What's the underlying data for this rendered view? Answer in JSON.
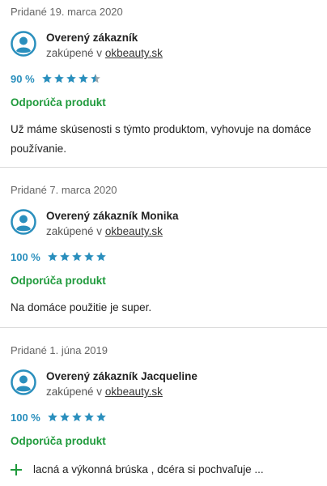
{
  "reviews": [
    {
      "date": "Pridané 19. marca 2020",
      "name": "Overený zákazník",
      "purchased_prefix": "zakúpené v ",
      "shop": "okbeauty.sk",
      "percent": "90 %",
      "stars": 4.5,
      "recommend": "Odporúča produkt",
      "text": "Už máme skúsenosti s týmto produktom, vyhovuje na domáce používanie."
    },
    {
      "date": "Pridané 7. marca 2020",
      "name": "Overený zákazník Monika",
      "purchased_prefix": "zakúpené v ",
      "shop": "okbeauty.sk",
      "percent": "100 %",
      "stars": 5,
      "recommend": "Odporúča produkt",
      "text": "Na domáce použitie je super."
    },
    {
      "date": "Pridané 1. júna 2019",
      "name": "Overený zákazník Jacqueline",
      "purchased_prefix": "zakúpené v ",
      "shop": "okbeauty.sk",
      "percent": "100 %",
      "stars": 5,
      "recommend": "Odporúča produkt",
      "pro": "lacná a výkonná brúska , dcéra si pochvaľuje ..."
    }
  ],
  "colors": {
    "star": "#2a8fbd",
    "star_empty": "#9aa6ad",
    "recommend": "#1f9a3c",
    "avatar": "#2a8fbd"
  },
  "icons": {
    "avatar": "user-avatar-icon",
    "star": "star-icon",
    "plus": "plus-icon"
  }
}
